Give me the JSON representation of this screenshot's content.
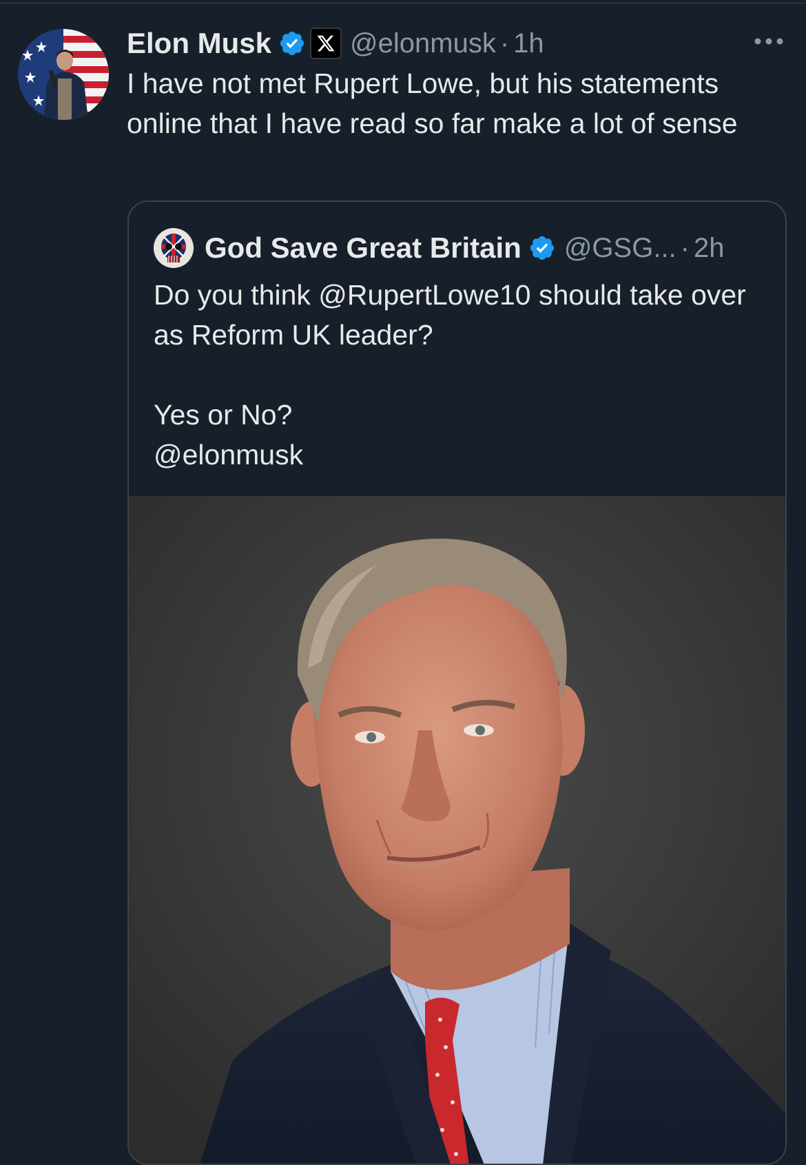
{
  "tweet": {
    "author_name": "Elon Musk",
    "author_handle": "@elonmusk",
    "separator": "·",
    "time": "1h",
    "text": "I have not met Rupert Lowe, but his statements online that I have read so far make a lot of sense",
    "avatar_icon": "profile-photo-flag-background",
    "verified_icon": "verified-badge-icon",
    "affiliate_icon": "x-logo-icon",
    "more_icon": "more-options-icon"
  },
  "quoted": {
    "author_name": "God Save Great Britain",
    "author_handle": "@GSG...",
    "separator": "·",
    "time": "2h",
    "text": "Do you think @RupertLowe10 should take over as Reform UK leader?\n\nYes or No?\n@elonmusk",
    "avatar_icon": "union-jack-skull-avatar",
    "verified_icon": "verified-badge-icon",
    "image_desc_icon": "portrait-photo"
  },
  "colors": {
    "background": "#17202a",
    "text": "#e7e9ea",
    "secondary_text": "#8b98a5",
    "border": "#38444d",
    "verified": "#1d9bf0"
  }
}
